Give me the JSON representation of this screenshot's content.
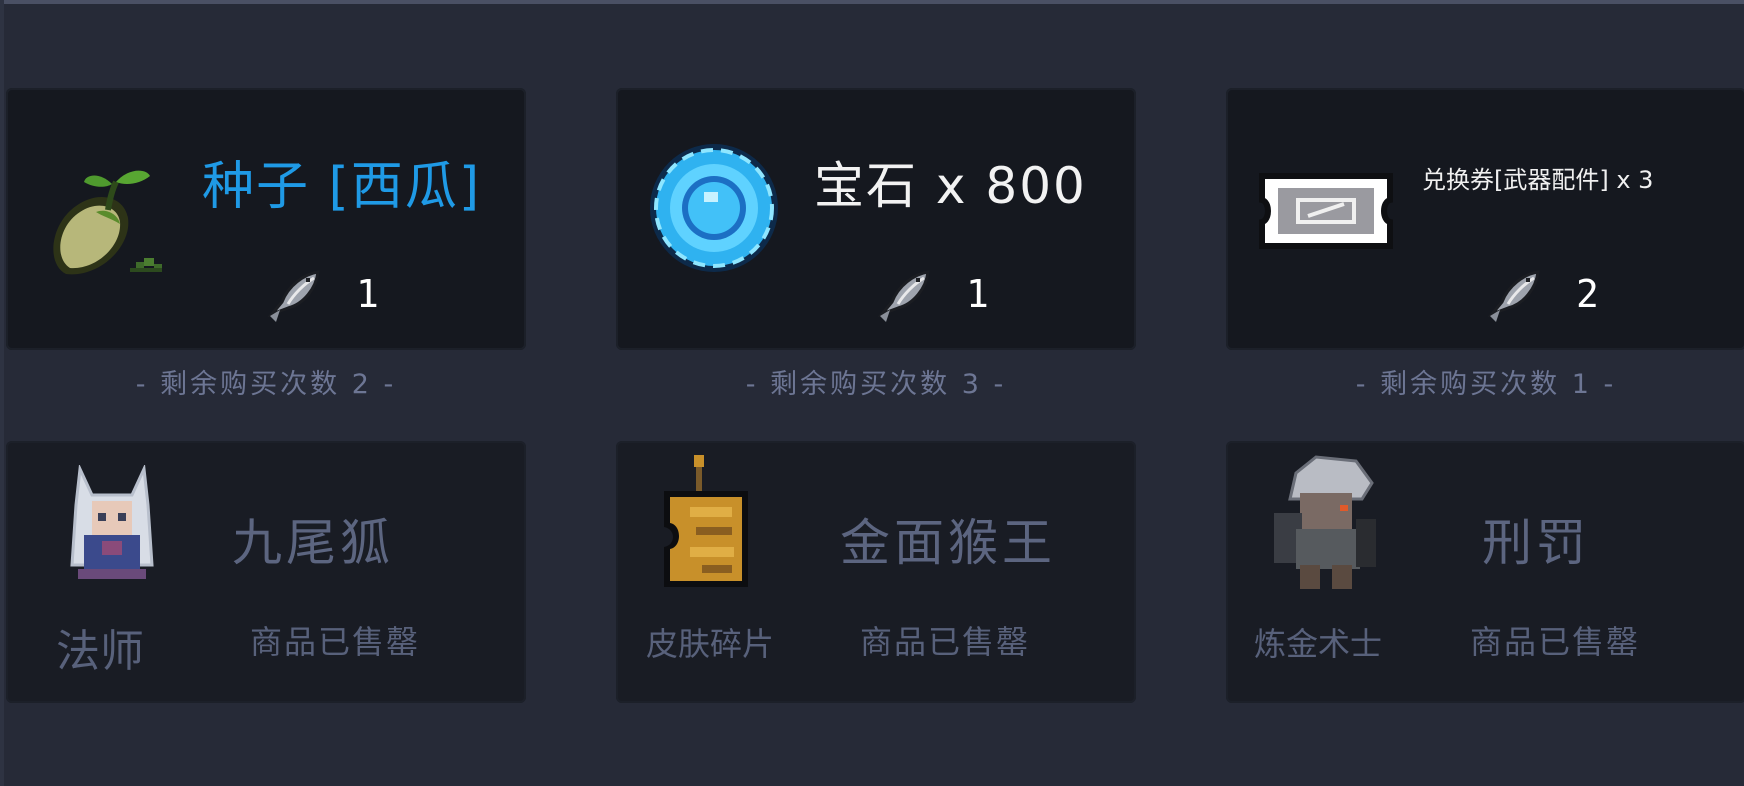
{
  "shop": {
    "items": [
      {
        "name": "种子 [西瓜]",
        "price": "1",
        "remaining": "- 剩余购买次数 2 -",
        "icon": "watermelon-seed-icon",
        "name_color": "#1f9ae6"
      },
      {
        "name": "宝石 x 800",
        "price": "1",
        "remaining": "- 剩余购买次数 3 -",
        "icon": "gem-icon"
      },
      {
        "name": "兑换券[武器配件] x 3",
        "price": "2",
        "remaining": "- 剩余购买次数 1 -",
        "icon": "coupon-ticket-icon"
      }
    ],
    "currency_icon": "fish-icon",
    "sold_items": [
      {
        "name": "九尾狐",
        "category": "法师",
        "status": "商品已售罄",
        "icon": "nine-tailed-fox-portrait-icon"
      },
      {
        "name": "金面猴王",
        "category": "皮肤碎片",
        "status": "商品已售罄",
        "icon": "skin-fragment-icon"
      },
      {
        "name": "刑罚",
        "category": "炼金术士",
        "status": "商品已售罄",
        "icon": "alchemist-portrait-icon"
      }
    ]
  }
}
